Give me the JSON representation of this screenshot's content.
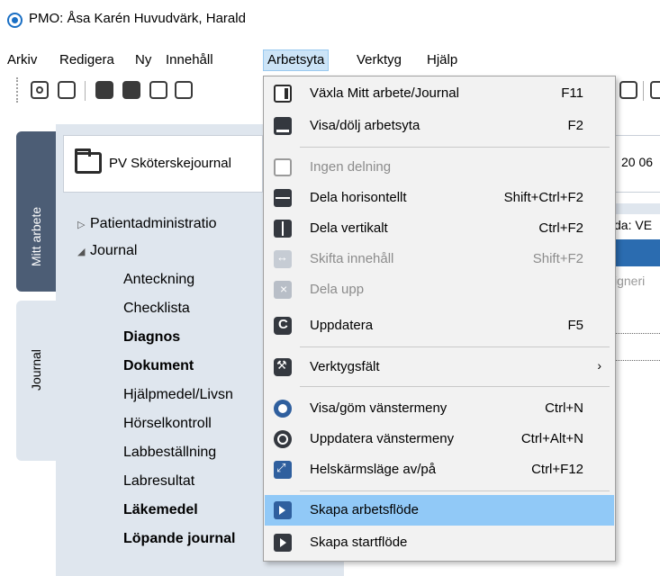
{
  "window": {
    "title": "PMO: Åsa Karén  Huvudvärk, Harald"
  },
  "menubar": [
    {
      "label": "Arkiv"
    },
    {
      "label": "Redigera"
    },
    {
      "label": "Ny"
    },
    {
      "label": "Innehåll"
    },
    {
      "label": "Arbetsyta",
      "active": true
    },
    {
      "label": "Verktyg"
    },
    {
      "label": "Hjälp"
    }
  ],
  "tabs": {
    "mitt_arbete": "Mitt arbete",
    "journal": "Journal"
  },
  "panel": {
    "title": "PV Sköterskejournal",
    "tree": [
      {
        "label": "Patientadministratio",
        "arrow": "▷",
        "bold": false
      },
      {
        "label": "Journal",
        "arrow": "◢",
        "bold": false
      },
      {
        "label": "Anteckning",
        "bold": false
      },
      {
        "label": "Checklista",
        "bold": false
      },
      {
        "label": "Diagnos",
        "bold": true
      },
      {
        "label": "Dokument",
        "bold": true
      },
      {
        "label": "Hjälpmedel/Livsn",
        "bold": false
      },
      {
        "label": "Hörselkontroll",
        "bold": false
      },
      {
        "label": "Labbeställning",
        "bold": false
      },
      {
        "label": "Labresultat",
        "bold": false
      },
      {
        "label": "Läkemedel",
        "bold": true
      },
      {
        "label": "Löpande journal",
        "bold": true
      }
    ]
  },
  "background": {
    "date": "20 06",
    "label": "da: VE",
    "grey": "igneri"
  },
  "dropdown": {
    "items": [
      {
        "label": "Växla Mitt arbete/Journal",
        "shortcut": "F11",
        "icon": "switch-icon",
        "disabled": false
      },
      {
        "label": "Visa/dölj arbetsyta",
        "shortcut": "F2",
        "icon": "panel-icon",
        "disabled": false
      },
      {
        "label": "Ingen delning",
        "shortcut": "",
        "icon": "no-split-icon",
        "disabled": true
      },
      {
        "label": "Dela horisontellt",
        "shortcut": "Shift+Ctrl+F2",
        "icon": "split-horizontal-icon",
        "disabled": false
      },
      {
        "label": "Dela vertikalt",
        "shortcut": "Ctrl+F2",
        "icon": "split-vertical-icon",
        "disabled": false
      },
      {
        "label": "Skifta innehåll",
        "shortcut": "Shift+F2",
        "icon": "swap-icon",
        "disabled": true
      },
      {
        "label": "Dela upp",
        "shortcut": "",
        "icon": "unsplit-icon",
        "disabled": true
      },
      {
        "label": "Uppdatera",
        "shortcut": "F5",
        "icon": "refresh-icon",
        "disabled": false
      },
      {
        "label": "Verktygsfält",
        "shortcut": "",
        "submenu": "›",
        "icon": "wrench-icon",
        "disabled": false
      },
      {
        "label": "Visa/göm vänstermeny",
        "shortcut": "Ctrl+N",
        "icon": "toggle-menu-icon",
        "disabled": false
      },
      {
        "label": "Uppdatera vänstermeny",
        "shortcut": "Ctrl+Alt+N",
        "icon": "refresh-menu-icon",
        "disabled": false
      },
      {
        "label": "Helskärmsläge av/på",
        "shortcut": "Ctrl+F12",
        "icon": "fullscreen-icon",
        "disabled": false
      },
      {
        "label": "Skapa arbetsflöde",
        "shortcut": "",
        "icon": "workflow-icon",
        "disabled": false,
        "highlighted": true
      },
      {
        "label": "Skapa startflöde",
        "shortcut": "",
        "icon": "startflow-icon",
        "disabled": false
      }
    ]
  }
}
